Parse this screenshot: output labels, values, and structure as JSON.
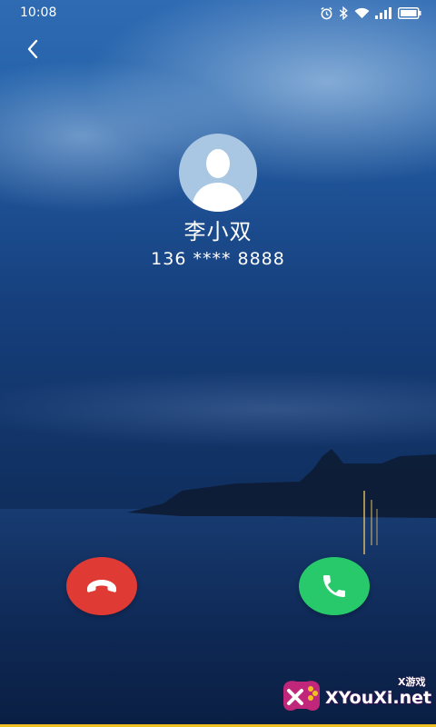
{
  "status_bar": {
    "time": "10:08",
    "icons": [
      "alarm-icon",
      "bluetooth-icon",
      "wifi-icon",
      "signal-icon",
      "battery-icon"
    ]
  },
  "nav": {
    "back_icon": "chevron-left-icon"
  },
  "caller": {
    "name": "李小双",
    "number": "136 **** 8888",
    "avatar_icon": "person-silhouette-icon"
  },
  "actions": {
    "decline_icon": "phone-hangup-icon",
    "decline_color": "#e03a35",
    "answer_icon": "phone-icon",
    "answer_color": "#27c96a"
  },
  "watermark": {
    "site": "XYouXi.net",
    "tag": "X游戏"
  }
}
